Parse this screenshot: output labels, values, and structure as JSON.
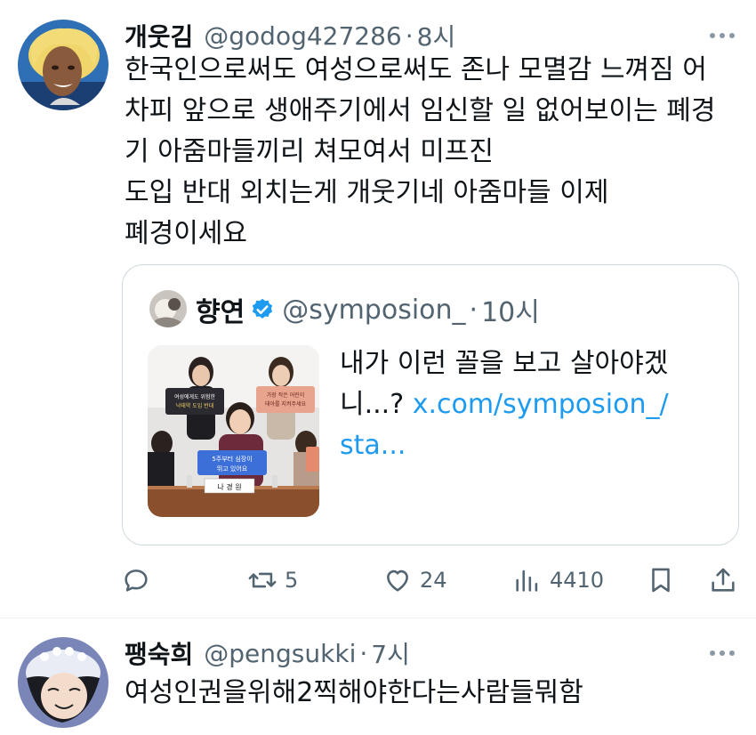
{
  "tweets": [
    {
      "display_name": "개웃김",
      "handle": "@godog427286",
      "separator": "·",
      "time": "8시",
      "text_lines": [
        "한국인으로써도 여성으로써도 존나 모멸감 느껴짐 어",
        "차피 앞으로 생애주기에서 임신할 일 없어보이는 폐경",
        "기 아줌마들끼리 쳐모여서 미프진",
        "도입 반대 외치는게 개웃기네 아줌마들 이제",
        "폐경이세요"
      ],
      "quote": {
        "display_name": "향연",
        "handle": "@symposion_",
        "separator": "·",
        "time": "10시",
        "text": "내가 이런 꼴을 보고 살아야겠니...?",
        "link_line1": "x.com/symposion_/",
        "link_line2": "sta...",
        "thumbnail_signs": [
          "여성에게도 위험한 낙태약 도입 반대",
          "가장 작은 어린이 태아를 지켜주세요",
          "5주부터 심장이 뛰고 있어요",
          "나 경 원"
        ]
      },
      "actions": {
        "reply_count": "",
        "retweet_count": "5",
        "like_count": "24",
        "view_count": "4410"
      }
    },
    {
      "display_name": "팽숙희",
      "handle": "@pengsukki",
      "separator": "·",
      "time": "7시",
      "text_lines": [
        "여성인권을위해2찍해야한다는사람들뭐함"
      ]
    }
  ],
  "icons": {
    "more": "more-horizontal-icon",
    "reply": "reply-icon",
    "retweet": "retweet-icon",
    "like": "heart-icon",
    "views": "views-icon",
    "bookmark": "bookmark-icon",
    "share": "share-icon",
    "verified": "verified-badge-icon"
  },
  "colors": {
    "text": "#0f1419",
    "secondary": "#536471",
    "link": "#1d9bf0",
    "border": "#cfd9de",
    "verified": "#1d9bf0"
  }
}
